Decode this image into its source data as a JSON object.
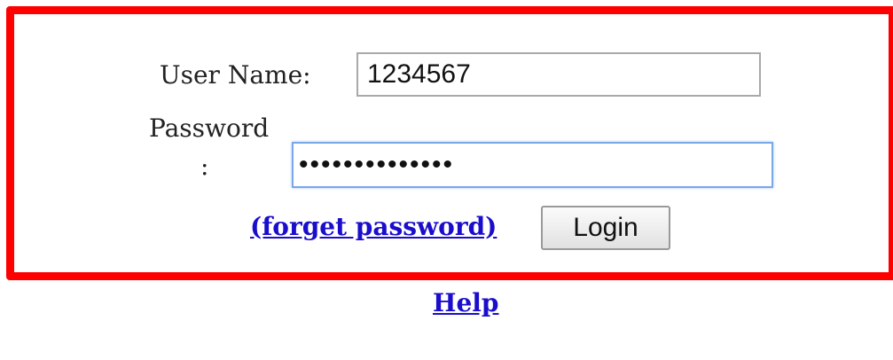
{
  "login_form": {
    "username_label": "User Name:",
    "username_value": "1234567",
    "password_label": "Password",
    "password_colon": ":",
    "password_masked": "••••••••••••••",
    "forget_password_link": "(forget password)",
    "login_button": "Login"
  },
  "help_link": "Help",
  "colors": {
    "highlight_border": "#ff0000",
    "link": "#1a0dcc",
    "focused_input_border": "#7aa7e8"
  }
}
